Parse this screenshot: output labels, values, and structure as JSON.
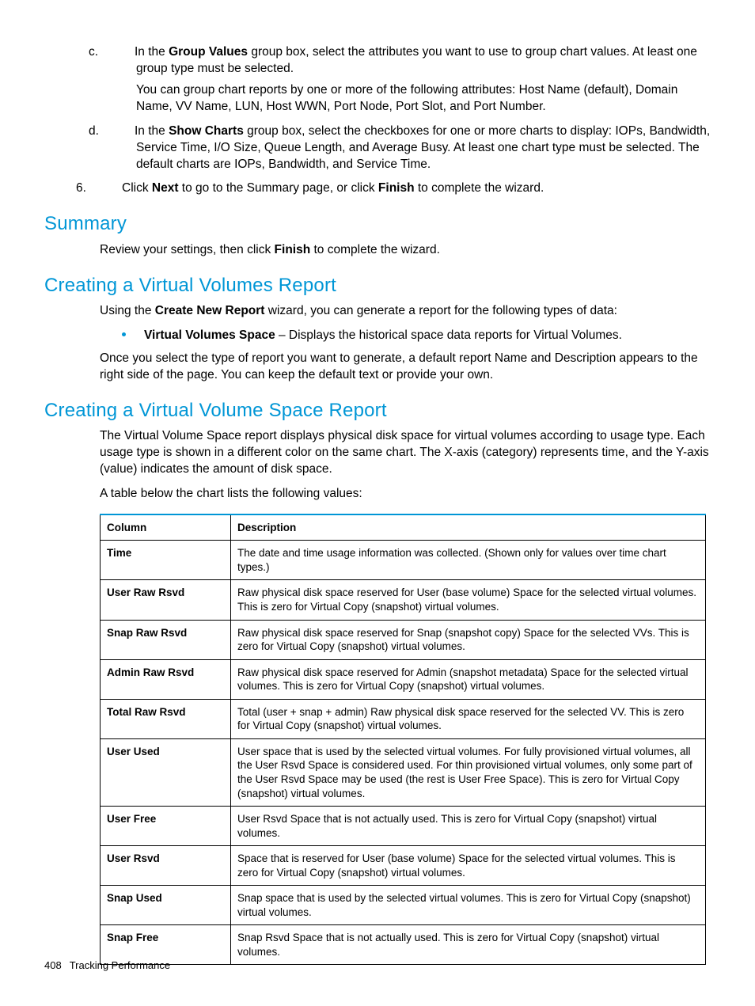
{
  "step_c": {
    "marker": "c.",
    "line1_pre": "In the ",
    "bold1": "Group Values",
    "line1_post": " group box, select the attributes you want to use to group chart values. At least one group type must be selected.",
    "para2": "You can group chart reports by one or more of the following attributes: Host Name (default), Domain Name, VV Name, LUN, Host WWN, Port Node, Port Slot, and Port Number."
  },
  "step_d": {
    "marker": "d.",
    "pre": "In the ",
    "bold": "Show Charts",
    "post": " group box, select the checkboxes for one or more charts to display: IOPs, Bandwidth, Service Time, I/O Size, Queue Length, and Average Busy. At least one chart type must be selected. The default charts are IOPs, Bandwidth, and Service Time."
  },
  "step6": {
    "marker": "6.",
    "p1": "Click ",
    "b1": "Next",
    "p2": " to go to the Summary page, or click ",
    "b2": "Finish",
    "p3": " to complete the wizard."
  },
  "summary": {
    "heading": "Summary",
    "p1": "Review your settings, then click ",
    "b1": "Finish",
    "p2": " to complete the wizard."
  },
  "vv_report": {
    "heading": "Creating a Virtual Volumes Report",
    "intro_p1": "Using the ",
    "intro_b1": "Create New Report",
    "intro_p2": " wizard, you can generate a report for the following types of data:",
    "bullet_b": "Virtual Volumes Space",
    "bullet_post": " – Displays the historical space data reports for Virtual Volumes.",
    "para2": "Once you select the type of report you want to generate, a default report Name and Description appears to the right side of the page. You can keep the default text or provide your own."
  },
  "vvs_report": {
    "heading": "Creating a Virtual Volume Space Report",
    "p1": "The Virtual Volume Space report displays physical disk space for virtual volumes according to usage type. Each usage type is shown in a different color on the same chart. The X-axis (category) represents time, and the Y-axis (value) indicates the amount of disk space.",
    "p2": "A table below the chart lists the following values:"
  },
  "table": {
    "h1": "Column",
    "h2": "Description",
    "rows": [
      {
        "c": "Time",
        "d": "The date and time usage information was collected. (Shown only for values over time chart types.)"
      },
      {
        "c": "User Raw Rsvd",
        "d": "Raw physical disk space reserved for User (base volume) Space for the selected virtual volumes. This is zero for Virtual Copy (snapshot) virtual volumes."
      },
      {
        "c": "Snap Raw Rsvd",
        "d": "Raw physical disk space reserved for Snap (snapshot copy) Space for the selected VVs. This is zero for Virtual Copy (snapshot) virtual volumes."
      },
      {
        "c": "Admin Raw Rsvd",
        "d": "Raw physical disk space reserved for Admin (snapshot metadata) Space for the selected virtual volumes. This is zero for Virtual Copy (snapshot) virtual volumes."
      },
      {
        "c": "Total Raw Rsvd",
        "d": "Total (user + snap + admin) Raw physical disk space reserved for the selected VV. This is zero for Virtual Copy (snapshot) virtual volumes."
      },
      {
        "c": "User Used",
        "d": "User space that is used by the selected virtual volumes. For fully provisioned virtual volumes, all the User Rsvd Space is considered used. For thin provisioned virtual volumes, only some part of the User Rsvd Space may be used (the rest is User Free Space). This is zero for Virtual Copy (snapshot) virtual volumes."
      },
      {
        "c": "User Free",
        "d": "User Rsvd Space that is not actually used. This is zero for Virtual Copy (snapshot) virtual volumes."
      },
      {
        "c": "User Rsvd",
        "d": "Space that is reserved for User (base volume) Space for the selected virtual volumes. This is zero for Virtual Copy (snapshot) virtual volumes."
      },
      {
        "c": "Snap Used",
        "d": "Snap space that is used by the selected virtual volumes. This is zero for Virtual Copy (snapshot) virtual volumes."
      },
      {
        "c": "Snap Free",
        "d": "Snap Rsvd Space that is not actually used. This is zero for Virtual Copy (snapshot) virtual volumes."
      }
    ]
  },
  "footer": {
    "page": "408",
    "title": "Tracking Performance"
  }
}
